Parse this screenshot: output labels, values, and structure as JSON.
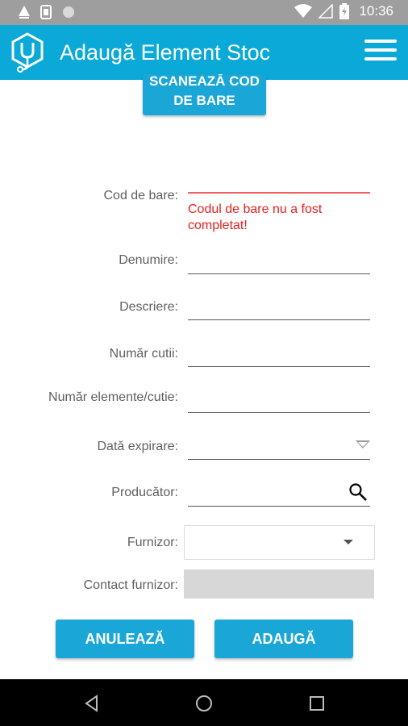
{
  "status_bar": {
    "time": "10:36",
    "icons": [
      "warning-icon",
      "sim-icon",
      "circle-icon",
      "wifi-icon",
      "signal-icon",
      "battery-icon"
    ]
  },
  "app_bar": {
    "title": "Adaugă Element Stoc",
    "logo_icon": "stethoscope-logo-icon",
    "menu_icon": "hamburger-menu-icon",
    "color": "#0aa9d8"
  },
  "scan_button": {
    "line1": "SCANEAZĂ COD",
    "line2": "DE BARE"
  },
  "form": {
    "barcode": {
      "label": "Cod de bare:",
      "value": "",
      "error": "Codul de bare nu a fost completat!"
    },
    "name": {
      "label": "Denumire:",
      "value": ""
    },
    "description": {
      "label": "Descriere:",
      "value": ""
    },
    "box_count": {
      "label": "Număr cutii:",
      "value": ""
    },
    "items_per_box": {
      "label": "Număr elemente/cutie:",
      "value": ""
    },
    "expiry_date": {
      "label": "Dată expirare:",
      "value": ""
    },
    "manufacturer": {
      "label": "Producător:",
      "value": ""
    },
    "supplier": {
      "label": "Furnizor:",
      "value": ""
    },
    "supplier_contact": {
      "label": "Contact furnizor:",
      "value": ""
    }
  },
  "actions": {
    "cancel_label": "ANULEAZĂ",
    "add_label": "ADAUGĂ"
  },
  "colors": {
    "accent": "#1aa7d8",
    "error": "#e82020"
  },
  "nav_bar": {
    "icons": [
      "back-icon",
      "home-icon",
      "recents-icon"
    ]
  }
}
